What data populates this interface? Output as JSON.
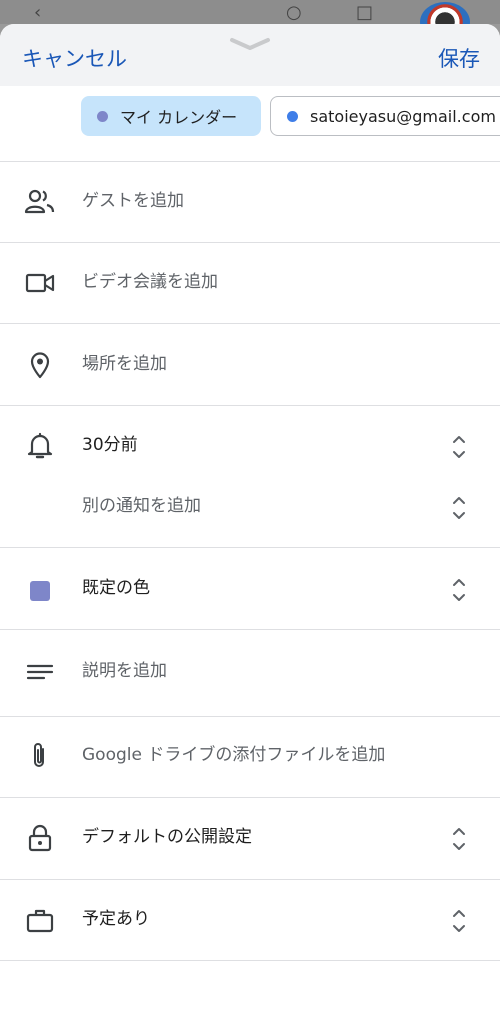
{
  "header": {
    "cancel_label": "キャンセル",
    "save_label": "保存"
  },
  "chips": [
    {
      "label": "マイ カレンダー",
      "dot_color": "#7e86c9",
      "selected": true
    },
    {
      "label": "satoieyasu@gmail.com",
      "dot_color": "#3f7ee8",
      "selected": false
    }
  ],
  "rows": {
    "guests": "ゲストを追加",
    "video": "ビデオ会議を追加",
    "location": "場所を追加",
    "notification": "30分前",
    "add_notification": "別の通知を追加",
    "color": "既定の色",
    "description": "説明を追加",
    "attachment": "Google ドライブの添付ファイルを追加",
    "visibility": "デフォルトの公開設定",
    "availability": "予定あり"
  },
  "colors": {
    "accent": "#1a57b7",
    "event_color": "#7e86c9",
    "chip_selected_bg": "#c6e4fb"
  },
  "icons": [
    "people-icon",
    "video-camera-icon",
    "location-pin-icon",
    "bell-icon",
    "color-swatch",
    "notes-icon",
    "paperclip-icon",
    "lock-icon",
    "briefcase-icon",
    "chevron-up-down-icon"
  ]
}
